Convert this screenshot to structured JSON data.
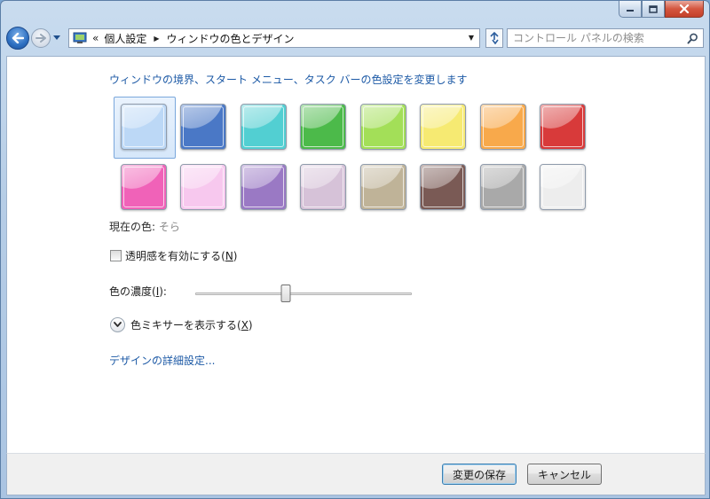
{
  "address_bar": {
    "chevron": "«",
    "crumbs": [
      "個人設定",
      "ウィンドウの色とデザイン"
    ]
  },
  "search": {
    "placeholder": "コントロール パネルの検索"
  },
  "main": {
    "heading": "ウィンドウの境界、スタート メニュー、タスク バーの色設定を変更します",
    "swatches": {
      "row1": [
        "#bcd8f6",
        "#4a78c6",
        "#52cfd2",
        "#4cba4a",
        "#a3df58",
        "#f6ea72",
        "#f8a94b",
        "#d83a3a"
      ],
      "row2": [
        "#f062b8",
        "#f7c8ee",
        "#9a79c4",
        "#d6c2d8",
        "#bfb398",
        "#7a5a55",
        "#a9a9a9",
        "#ededed"
      ],
      "selected_index": 0
    },
    "current_color": {
      "label": "現在の色:",
      "value": "そら"
    },
    "transparency": {
      "label": "透明感を有効にする(",
      "key": "N",
      "suffix": ")",
      "checked": false
    },
    "intensity": {
      "label": "色の濃度(",
      "key": "I",
      "suffix": "):",
      "value_percent": 42
    },
    "mixer": {
      "label": "色ミキサーを表示する(",
      "key": "X",
      "suffix": ")"
    },
    "advanced_link": "デザインの詳細設定..."
  },
  "footer": {
    "save_label": "変更の保存",
    "cancel_label": "キャンセル"
  },
  "icons": {
    "minimize": "minimize-icon",
    "maximize": "maximize-icon",
    "close": "close-icon",
    "back": "back-arrow-icon",
    "forward": "forward-arrow-icon",
    "refresh": "refresh-icon",
    "search": "search-icon",
    "control_panel": "control-panel-icon"
  }
}
